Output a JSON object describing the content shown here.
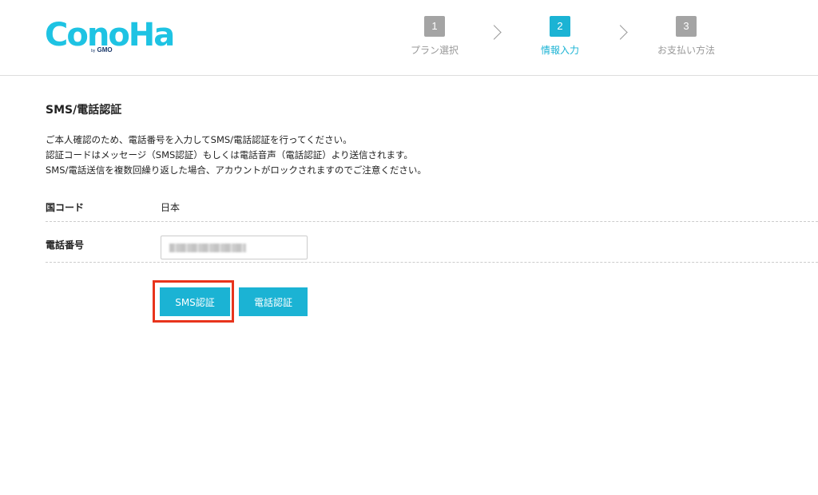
{
  "header": {
    "logo_text": "ConoHa",
    "logo_by": "by",
    "logo_brand": "GMO",
    "steps": [
      {
        "number": "1",
        "label": "プラン選択",
        "active": false
      },
      {
        "number": "2",
        "label": "情報入力",
        "active": true
      },
      {
        "number": "3",
        "label": "お支払い方法",
        "active": false
      }
    ]
  },
  "main": {
    "title": "SMS/電話認証",
    "description": [
      "ご本人確認のため、電話番号を入力してSMS/電話認証を行ってください。",
      "認証コードはメッセージ（SMS認証）もしくは電話音声（電話認証）より送信されます。",
      "SMS/電話送信を複数回繰り返した場合、アカウントがロックされますのでご注意ください。"
    ],
    "country_label": "国コード",
    "country_value": "日本",
    "phone_label": "電話番号",
    "phone_value": "",
    "sms_button": "SMS認証",
    "call_button": "電話認証"
  },
  "colors": {
    "accent": "#1bb3d4",
    "step_inactive": "#a4a4a4",
    "highlight": "#e8341c",
    "logo": "#1ec3e3"
  }
}
